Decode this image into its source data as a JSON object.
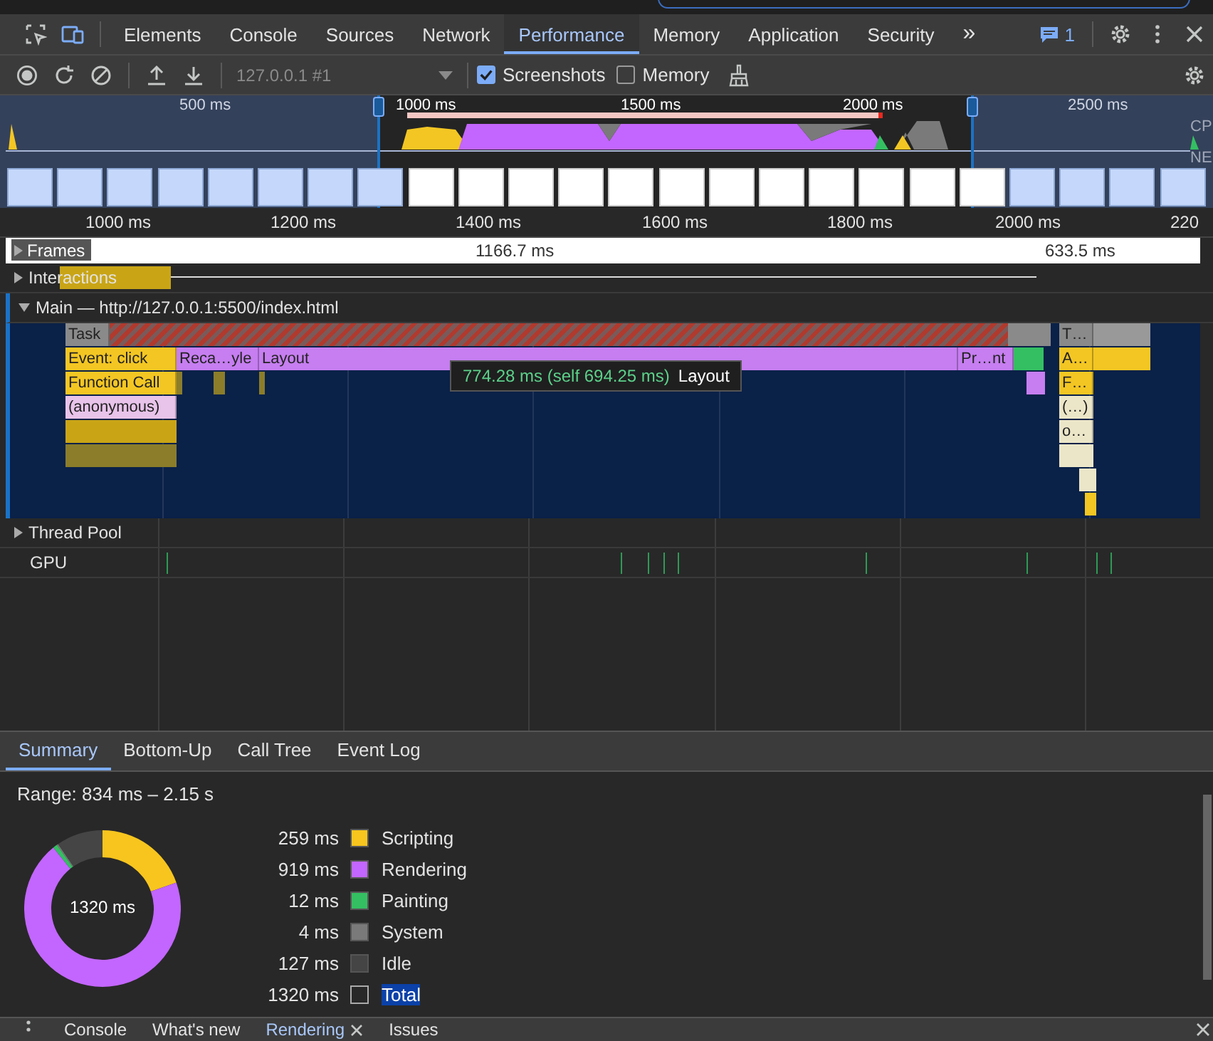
{
  "tabs": [
    {
      "label": "Elements",
      "selected": false
    },
    {
      "label": "Console",
      "selected": false
    },
    {
      "label": "Sources",
      "selected": false
    },
    {
      "label": "Network",
      "selected": false
    },
    {
      "label": "Performance",
      "selected": true
    },
    {
      "label": "Memory",
      "selected": false
    },
    {
      "label": "Application",
      "selected": false
    },
    {
      "label": "Security",
      "selected": false
    }
  ],
  "more_tabs": "»",
  "issues_count": "1",
  "toolbar": {
    "target": "127.0.0.1 #1",
    "checkboxes": [
      {
        "label": "Screenshots",
        "checked": true
      },
      {
        "label": "Memory",
        "checked": false
      }
    ]
  },
  "overview": {
    "time_labels": [
      "500 ms",
      "1000 ms",
      "1500 ms",
      "2000 ms",
      "2500 ms"
    ],
    "track_labels": [
      "CP",
      "NE"
    ]
  },
  "ruler": [
    "1000 ms",
    "1200 ms",
    "1400 ms",
    "1600 ms",
    "1800 ms",
    "2000 ms",
    "220"
  ],
  "frames": {
    "label": "Frames",
    "expanded": false,
    "durations": [
      "1166.7 ms",
      "633.5 ms"
    ]
  },
  "tracks": [
    {
      "label": "Interactions",
      "expanded": false
    },
    {
      "label": "Main — http://127.0.0.1:5500/index.html",
      "expanded": true
    }
  ],
  "flame_entries": [
    {
      "label": "Task",
      "kind": "task"
    },
    {
      "label": "Event: click",
      "kind": "scripting"
    },
    {
      "label": "Reca…yle",
      "kind": "rendering"
    },
    {
      "label": "Layout",
      "kind": "rendering"
    },
    {
      "label": "Pr…nt",
      "kind": "rendering"
    },
    {
      "label": "Function Call",
      "kind": "scripting"
    },
    {
      "label": "(anonymous)",
      "kind": "anonymous"
    },
    {
      "label": "T…",
      "kind": "task"
    },
    {
      "label": "A…",
      "kind": "scripting"
    },
    {
      "label": "F…",
      "kind": "scripting"
    },
    {
      "label": "(…)",
      "kind": "other"
    },
    {
      "label": "o…",
      "kind": "other"
    }
  ],
  "tooltip": {
    "duration": "774.28 ms (self 694.25 ms)",
    "name": "Layout"
  },
  "lower_tracks": [
    {
      "label": "Thread Pool",
      "expanded": false
    }
  ],
  "gpu_track": {
    "label": "GPU"
  },
  "summary": {
    "tabs": [
      {
        "label": "Summary",
        "selected": true
      },
      {
        "label": "Bottom-Up",
        "selected": false
      },
      {
        "label": "Call Tree",
        "selected": false
      },
      {
        "label": "Event Log",
        "selected": false
      }
    ],
    "range": "Range: 834 ms – 2.15 s",
    "chart_data": {
      "type": "donut",
      "categories": [
        "Scripting",
        "Rendering",
        "Painting",
        "System",
        "Idle"
      ],
      "series": [
        {
          "values": [
            19.6,
            69.6,
            0.9,
            0.3,
            9.6
          ]
        }
      ]
    },
    "center_label": "1320 ms",
    "legend": [
      {
        "value": "259 ms",
        "color": "#f7c51e"
      },
      {
        "value": "919 ms",
        "color": "#c266ff"
      },
      {
        "value": "12 ms",
        "color": "#34bf62"
      },
      {
        "value": "4 ms",
        "color": "#7a7a7a"
      },
      {
        "value": "127 ms",
        "color": "#454545"
      }
    ],
    "total": {
      "value": "1320 ms",
      "label": "Total"
    }
  },
  "drawer_tabs": [
    {
      "label": "Console",
      "selected": false
    },
    {
      "label": "What's new",
      "selected": false
    },
    {
      "label": "Rendering",
      "selected": true
    },
    {
      "label": "Issues",
      "selected": false
    }
  ]
}
